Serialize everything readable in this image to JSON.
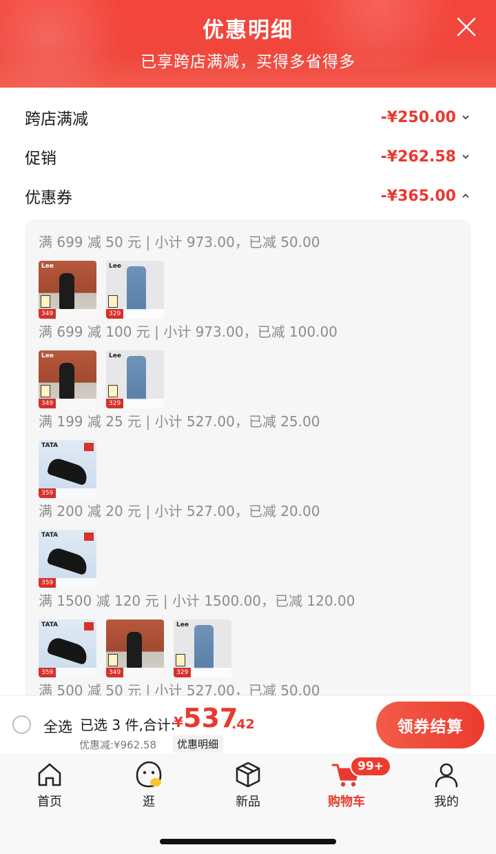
{
  "header": {
    "title": "优惠明细",
    "subtitle": "已享跨店满减，买得多省得多",
    "accent": "#f0463c"
  },
  "summary": [
    {
      "label": "跨店满减",
      "amount": "-¥250.00",
      "chevron": "chevron-down-icon"
    },
    {
      "label": "促销",
      "amount": "-¥262.58",
      "chevron": "chevron-down-icon"
    },
    {
      "label": "优惠券",
      "amount": "-¥365.00",
      "chevron": "chevron-up-icon"
    }
  ],
  "coupons": [
    {
      "title": "满 699 减 50 元 | 小计 973.00，已减 50.00",
      "items": [
        {
          "kind": "street",
          "brand": "Lee",
          "price": "349"
        },
        {
          "kind": "jeans",
          "brand": "Lee",
          "price": "329"
        }
      ]
    },
    {
      "title": "满 699 减 100 元 | 小计 973.00，已减 100.00",
      "items": [
        {
          "kind": "street",
          "brand": "Lee",
          "price": "349"
        },
        {
          "kind": "jeans",
          "brand": "Lee",
          "price": "329"
        }
      ]
    },
    {
      "title": "满 199 减 25 元 | 小计 527.00，已减 25.00",
      "items": [
        {
          "kind": "shoe",
          "brand": "TATA",
          "price": "359"
        }
      ]
    },
    {
      "title": "满 200 减 20 元 | 小计 527.00，已减 20.00",
      "items": [
        {
          "kind": "shoe",
          "brand": "TATA",
          "price": "359"
        }
      ]
    },
    {
      "title": "满 1500 减 120 元 | 小计 1500.00，已减 120.00",
      "items": [
        {
          "kind": "shoe",
          "brand": "TATA",
          "price": "359"
        },
        {
          "kind": "street",
          "brand": "",
          "price": "349"
        },
        {
          "kind": "jeans",
          "brand": "Lee",
          "price": "329"
        }
      ]
    },
    {
      "title": "满 500 减 50 元 | 小计 527.00，已减 50.00",
      "items": []
    }
  ],
  "checkout": {
    "select_all": "全选",
    "selected_text": "已选 3 件,合计:",
    "currency": "¥",
    "total_int": "537",
    "total_dec": ".42",
    "discount_text": "优惠减:¥962.58",
    "detail_link": "优惠明细",
    "pay_button": "领券结算"
  },
  "tabs": [
    {
      "label": "首页",
      "icon": "home-icon"
    },
    {
      "label": "逛",
      "icon": "mascot-icon"
    },
    {
      "label": "新品",
      "icon": "box-icon"
    },
    {
      "label": "购物车",
      "icon": "cart-icon",
      "badge": "99+"
    },
    {
      "label": "我的",
      "icon": "user-icon"
    }
  ]
}
